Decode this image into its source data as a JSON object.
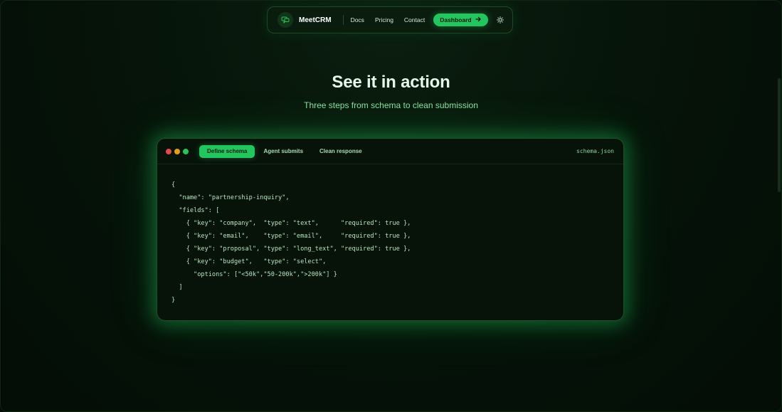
{
  "nav": {
    "brand": "MeetCRM",
    "links": [
      "Docs",
      "Pricing",
      "Contact"
    ],
    "dashboard_label": "Dashboard",
    "icons": {
      "logo": "chat-bubbles-icon",
      "dashboard_arrow": "arrow-right-icon",
      "theme_toggle": "sun-icon"
    }
  },
  "hero": {
    "title": "See it in action",
    "subtitle": "Three steps from schema to clean submission"
  },
  "code_window": {
    "tabs": [
      {
        "label": "Define schema",
        "active": true
      },
      {
        "label": "Agent submits",
        "active": false
      },
      {
        "label": "Clean response",
        "active": false
      }
    ],
    "filename": "schema.json",
    "lines": [
      "{",
      "  \"name\": \"partnership-inquiry\",",
      "  \"fields\": [",
      "    { \"key\": \"company\",  \"type\": \"text\",      \"required\": true },",
      "    { \"key\": \"email\",    \"type\": \"email\",     \"required\": true },",
      "    { \"key\": \"proposal\", \"type\": \"long_text\", \"required\": true },",
      "    { \"key\": \"budget\",   \"type\": \"select\",",
      "      \"options\": [\"<50k\",\"50-200k\",\">200k\"] }",
      "  ]",
      "}"
    ]
  },
  "colors": {
    "accent": "#22c55e",
    "background": "#061409",
    "dot_red": "#e5484d",
    "dot_yellow": "#e5a00d",
    "dot_green": "#22c55e"
  }
}
